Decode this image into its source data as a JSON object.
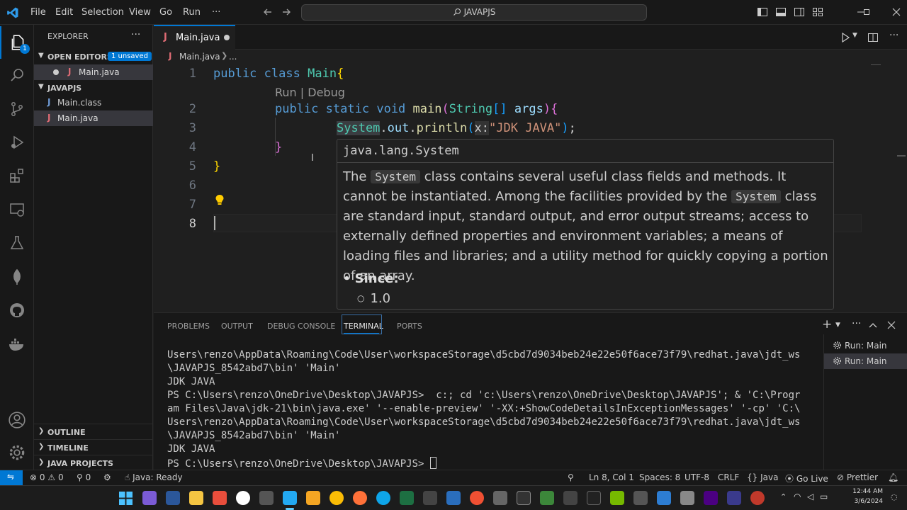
{
  "titlebar": {
    "menus": [
      "File",
      "Edit",
      "Selection",
      "View",
      "Go",
      "Run",
      "···"
    ],
    "search": "JAVAPJS"
  },
  "activity": {
    "explorer_badge": "1"
  },
  "sidebar": {
    "title": "EXPLORER",
    "more": "···",
    "open_editors": "OPEN EDITORS",
    "unsaved_badge": "1 unsaved",
    "open_file": "Main.java",
    "folder": "JAVAPJS",
    "files": [
      "Main.class",
      "Main.java"
    ],
    "outline": "OUTLINE",
    "timeline": "TIMELINE",
    "java_projects": "JAVA PROJECTS"
  },
  "editor": {
    "tab_label": "Main.java",
    "breadcrumb_file": "Main.java",
    "breadcrumb_more": "...",
    "codelens": "Run | Debug",
    "line_numbers": [
      "1",
      "2",
      "3",
      "4",
      "5",
      "6",
      "7",
      "8"
    ],
    "code": {
      "l1_kw1": "public",
      "l1_kw2": "class",
      "l1_name": "Main",
      "l1_brace": "{",
      "l2_kw1": "public",
      "l2_kw2": "static",
      "l2_kw3": "void",
      "l2_fn": "main",
      "l2_open": "(",
      "l2_type": "String",
      "l2_arr": "[]",
      "l2_arg": "args",
      "l2_close": ")",
      "l2_brace": "{",
      "l3_cls": "System",
      "l3_dot1": ".",
      "l3_out": "out",
      "l3_dot2": ".",
      "l3_fn": "println",
      "l3_open": "(",
      "l3_hint": "x:",
      "l3_str": "\"JDK JAVA\"",
      "l3_close": ")",
      "l3_semi": ";",
      "l4_brace": "}",
      "l5_brace": "}"
    }
  },
  "hover": {
    "signature": "java.lang.System",
    "doc_1": "The ",
    "doc_code1": "System",
    "doc_2": " class contains several useful class fields and methods. It cannot be instantiated. Among the facilities provided by the ",
    "doc_code2": "System",
    "doc_3": " class are standard input, standard output, and error output streams; access to externally defined properties and environment variables; a means of loading files and libraries; and a utility method for quickly copying a portion of an array.",
    "since_label": "Since:",
    "since_value": "1.0"
  },
  "panel": {
    "tabs": [
      "PROBLEMS",
      "OUTPUT",
      "DEBUG CONSOLE",
      "TERMINAL",
      "PORTS"
    ],
    "terminal_lines": [
      "Users\\renzo\\AppData\\Roaming\\Code\\User\\workspaceStorage\\d5cbd7d9034beb24e22e50f6ace73f79\\redhat.java\\jdt_ws",
      "\\JAVAPJS_8542abd7\\bin' 'Main'",
      "JDK JAVA",
      "PS C:\\Users\\renzo\\OneDrive\\Desktop\\JAVAPJS>  c:; cd 'c:\\Users\\renzo\\OneDrive\\Desktop\\JAVAPJS'; & 'C:\\Progr",
      "am Files\\Java\\jdk-21\\bin\\java.exe' '--enable-preview' '-XX:+ShowCodeDetailsInExceptionMessages' '-cp' 'C:\\",
      "Users\\renzo\\AppData\\Roaming\\Code\\User\\workspaceStorage\\d5cbd7d9034beb24e22e50f6ace73f79\\redhat.java\\jdt_ws",
      "\\JAVAPJS_8542abd7\\bin' 'Main'",
      "JDK JAVA",
      "PS C:\\Users\\renzo\\OneDrive\\Desktop\\JAVAPJS> "
    ],
    "terminal_instances": [
      "Run: Main",
      "Run: Main"
    ]
  },
  "statusbar": {
    "errors": "0",
    "warnings": "0",
    "ports": "0",
    "java_status": "Java: Ready",
    "position": "Ln 8, Col 1",
    "spaces": "Spaces: 8",
    "encoding": "UTF-8",
    "eol": "CRLF",
    "language": "Java",
    "golive": "Go Live",
    "prettier": "Prettier"
  },
  "taskbar": {
    "time": "12:44 AM",
    "date": "3/6/2024"
  },
  "colors": {
    "accent": "#0078d4",
    "badge": "#0078d4"
  }
}
